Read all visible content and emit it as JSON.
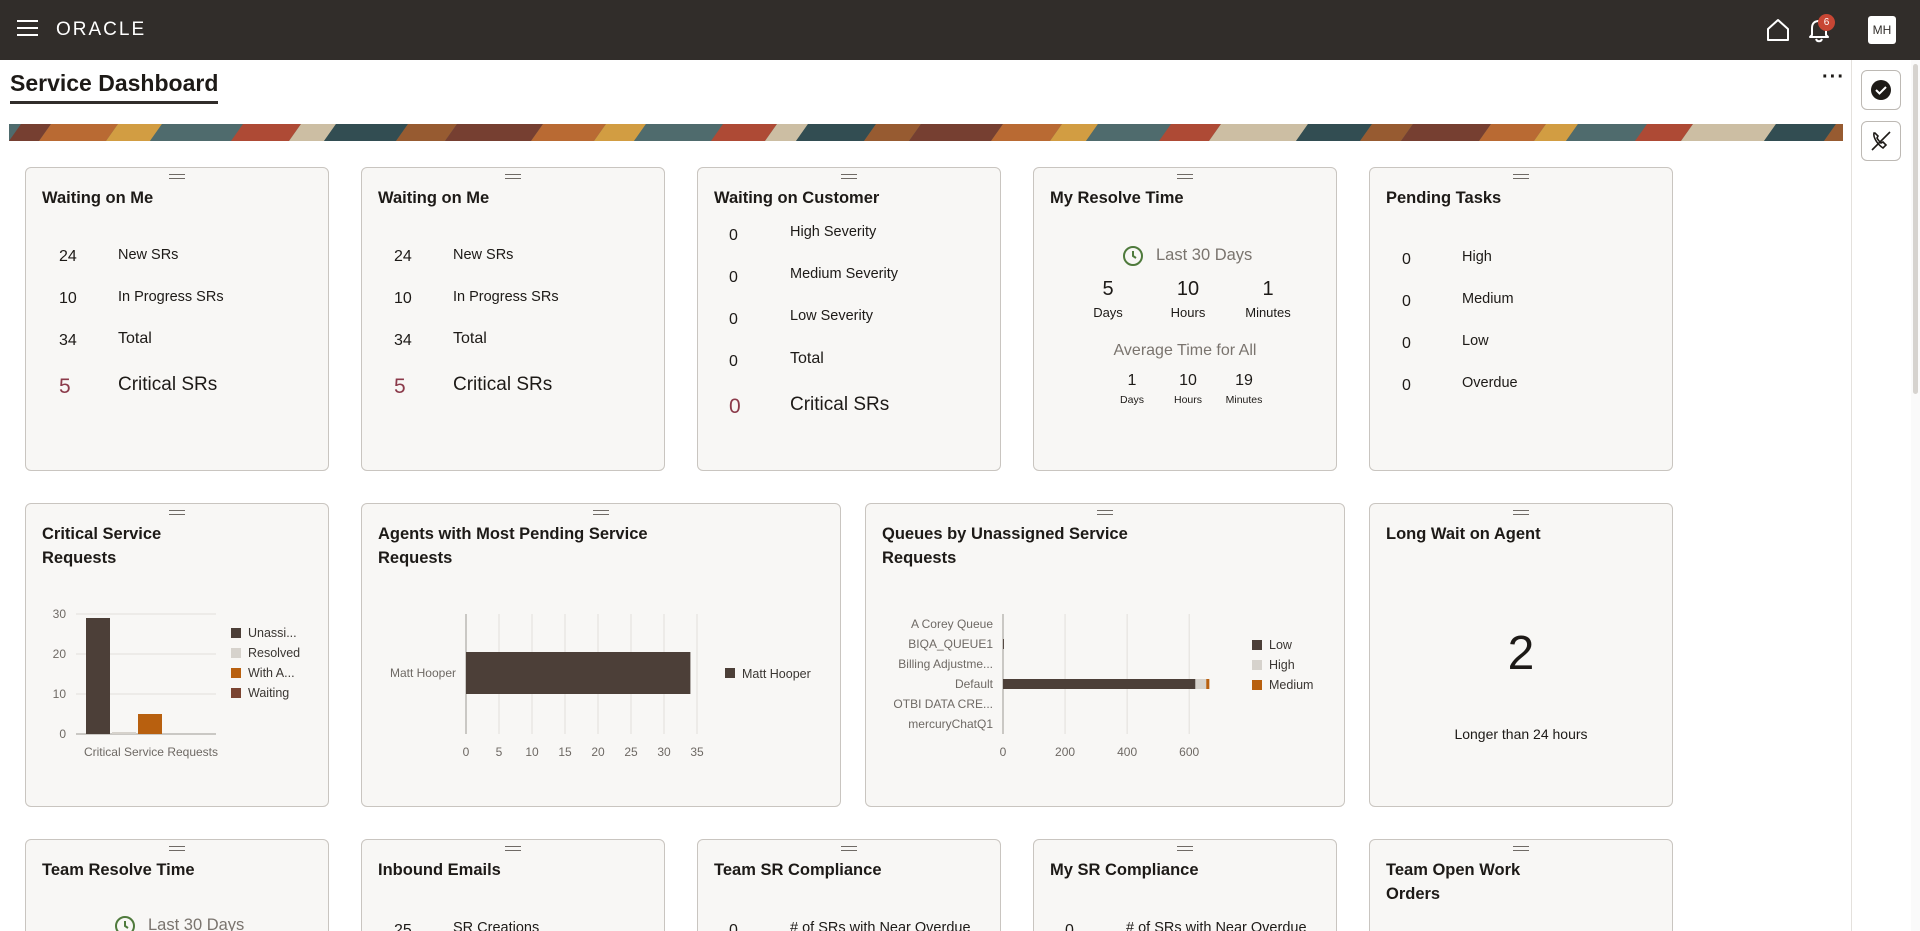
{
  "app": {
    "brand": "ORACLE",
    "notification_count": "6",
    "user_initials": "MH"
  },
  "page": {
    "title": "Service Dashboard",
    "more": "···"
  },
  "colors": {
    "topbar": "#312d2a",
    "critical": "#8b3a4a",
    "low": "#4c3f38",
    "high": "#d6d2cc",
    "medium": "#b8600f",
    "waiting": "#7a4431",
    "clock": "#4f7a3c"
  },
  "cards": {
    "waiting_on_me_1": {
      "title": "Waiting on Me",
      "rows": [
        {
          "value": "24",
          "label": "New SRs"
        },
        {
          "value": "10",
          "label": "In Progress SRs"
        },
        {
          "value": "34",
          "label": "Total"
        }
      ],
      "critical": {
        "value": "5",
        "label": "Critical SRs"
      }
    },
    "waiting_on_me_2": {
      "title": "Waiting on Me",
      "rows": [
        {
          "value": "24",
          "label": "New SRs"
        },
        {
          "value": "10",
          "label": "In Progress SRs"
        },
        {
          "value": "34",
          "label": "Total"
        }
      ],
      "critical": {
        "value": "5",
        "label": "Critical SRs"
      }
    },
    "waiting_on_customer": {
      "title": "Waiting on Customer",
      "rows": [
        {
          "value": "0",
          "label": "High Severity"
        },
        {
          "value": "0",
          "label": "Medium Severity"
        },
        {
          "value": "0",
          "label": "Low Severity"
        },
        {
          "value": "0",
          "label": "Total"
        }
      ],
      "critical": {
        "value": "0",
        "label": "Critical SRs"
      }
    },
    "my_resolve_time": {
      "title": "My Resolve Time",
      "period": "Last 30 Days",
      "mine": [
        {
          "value": "5",
          "unit": "Days"
        },
        {
          "value": "10",
          "unit": "Hours"
        },
        {
          "value": "1",
          "unit": "Minutes"
        }
      ],
      "avg_label": "Average Time for All",
      "avg": [
        {
          "value": "1",
          "unit": "Days"
        },
        {
          "value": "10",
          "unit": "Hours"
        },
        {
          "value": "19",
          "unit": "Minutes"
        }
      ]
    },
    "pending_tasks": {
      "title": "Pending Tasks",
      "rows": [
        {
          "value": "0",
          "label": "High"
        },
        {
          "value": "0",
          "label": "Medium"
        },
        {
          "value": "0",
          "label": "Low"
        },
        {
          "value": "0",
          "label": "Overdue"
        }
      ]
    },
    "critical_sr": {
      "title": "Critical Service Requests"
    },
    "agents_pending": {
      "title": "Agents with Most Pending Service Requests"
    },
    "queues_unassigned": {
      "title": "Queues by Unassigned Service Requests"
    },
    "long_wait": {
      "title": "Long Wait on Agent",
      "value": "2",
      "caption": "Longer than 24 hours"
    },
    "team_resolve_time": {
      "title": "Team Resolve Time",
      "period": "Last 30 Days"
    },
    "inbound_emails": {
      "title": "Inbound Emails",
      "first_value": "25",
      "first_label": "SR Creations"
    },
    "team_sr_compliance": {
      "title": "Team SR Compliance",
      "first_value": "0",
      "first_label": "# of SRs with Near Overdue"
    },
    "my_sr_compliance": {
      "title": "My SR Compliance",
      "first_value": "0",
      "first_label": "# of SRs with Near Overdue"
    },
    "team_open_work_orders": {
      "title": "Team Open Work Orders"
    }
  },
  "chart_data": [
    {
      "type": "bar",
      "categories": [
        "Critical Service Requests"
      ],
      "xlabel": "",
      "ylabel": "",
      "ylim": [
        0,
        30
      ],
      "yticks": [
        "0",
        "10",
        "20",
        "30"
      ],
      "series": [
        {
          "name": "Unassi...",
          "values": [
            29
          ],
          "color": "#4c3f38"
        },
        {
          "name": "Resolved",
          "values": [
            0.5
          ],
          "color": "#d6d2cc"
        },
        {
          "name": "With A...",
          "values": [
            5
          ],
          "color": "#b8600f"
        },
        {
          "name": "Waiting",
          "values": [
            0
          ],
          "color": "#7a4431"
        }
      ],
      "legend": "right"
    },
    {
      "type": "bar",
      "orientation": "horizontal",
      "categories": [
        "Matt Hooper"
      ],
      "xlim": [
        0,
        35
      ],
      "xticks": [
        "0",
        "5",
        "10",
        "15",
        "20",
        "25",
        "30",
        "35"
      ],
      "series": [
        {
          "name": "Matt Hooper",
          "values": [
            34
          ],
          "color": "#4c3f38"
        }
      ],
      "legend": "right"
    },
    {
      "type": "bar",
      "orientation": "horizontal",
      "stacked": true,
      "categories": [
        "A Corey Queue",
        "BIQA_QUEUE1",
        "Billing Adjustme...",
        "Default",
        "OTBI DATA CRE...",
        "mercuryChatQ1"
      ],
      "xlim": [
        0,
        680
      ],
      "xticks": [
        "0",
        "200",
        "400",
        "600"
      ],
      "series": [
        {
          "name": "Low",
          "values": [
            0,
            3,
            0,
            620,
            0,
            0
          ],
          "color": "#4c3f38"
        },
        {
          "name": "High",
          "values": [
            0,
            0,
            0,
            35,
            0,
            0
          ],
          "color": "#d6d2cc"
        },
        {
          "name": "Medium",
          "values": [
            0,
            0,
            0,
            10,
            0,
            0
          ],
          "color": "#b8600f"
        }
      ],
      "legend": "right"
    }
  ]
}
